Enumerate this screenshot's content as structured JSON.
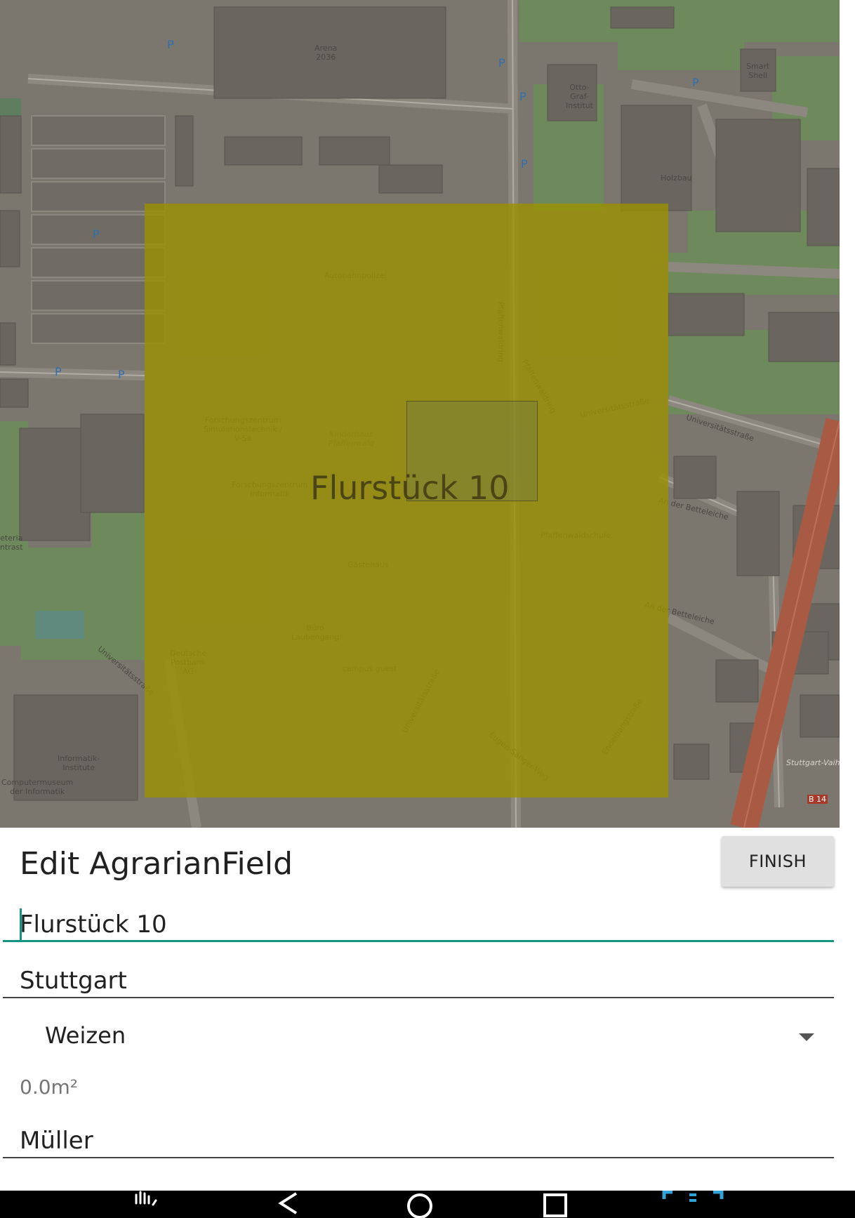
{
  "map": {
    "field_label": "Flurstück 10",
    "labels": {
      "arena": "Arena\n2036",
      "otto_graf": "Otto-\nGraf-\nInstitut",
      "smart_shell": "Smart\nShell",
      "holzbau": "Holzbau",
      "autobahnpolizei": "Autobahnpolizei",
      "forschungszentrum_sim": "Forschungszentrum\nSimulationstechnik /\nV-Sa",
      "kinderhaus": "Kinderhaus\nPfaffenwald",
      "forschungszentrum_inf": "Forschungszentrum\nInformatik",
      "pfaffenwaldring": "Pfaffenwaldring",
      "universitaetsstrasse": "Universitätsstraße",
      "an_der_betteleiche": "An der Betteleiche",
      "pfaffenwaldschule": "Pfaffenwaldschule",
      "gastehaus": "Gästehaus",
      "buero_laubengang": "Büro\nLaubengang",
      "campus_guest": "campus guest",
      "deutsche_postbank": "Deutsche\nPostbank\nAG",
      "informatik_institute": "Informatik-\nInstitute",
      "computermuseum": "Computermuseum\nder Informatik",
      "eugen_saenger_weg": "Eugen-Sänger-Weg",
      "endelbangstrasse": "Endelbangstraße",
      "stuttgart_vaihingen": "Stuttgart-Vaihi",
      "b14": "B 14",
      "cafeteria": "eteria\nntrast"
    }
  },
  "panel": {
    "title": "Edit AgrarianField",
    "finish_label": "FINISH",
    "name_value": "Flurstück 10",
    "city_value": "Stuttgart",
    "crop_value": "Weizen",
    "area_text": "0.0m²",
    "owner_value": "Müller"
  },
  "nav": {
    "icons": [
      "hand-gesture-icon",
      "back-icon",
      "home-icon",
      "recents-icon",
      "screenshot-frame-icon"
    ]
  },
  "colors": {
    "accent": "#159484",
    "field_overlay": "#9b9100",
    "map_base": "#7b776f",
    "map_green": "#6e8a5c"
  }
}
